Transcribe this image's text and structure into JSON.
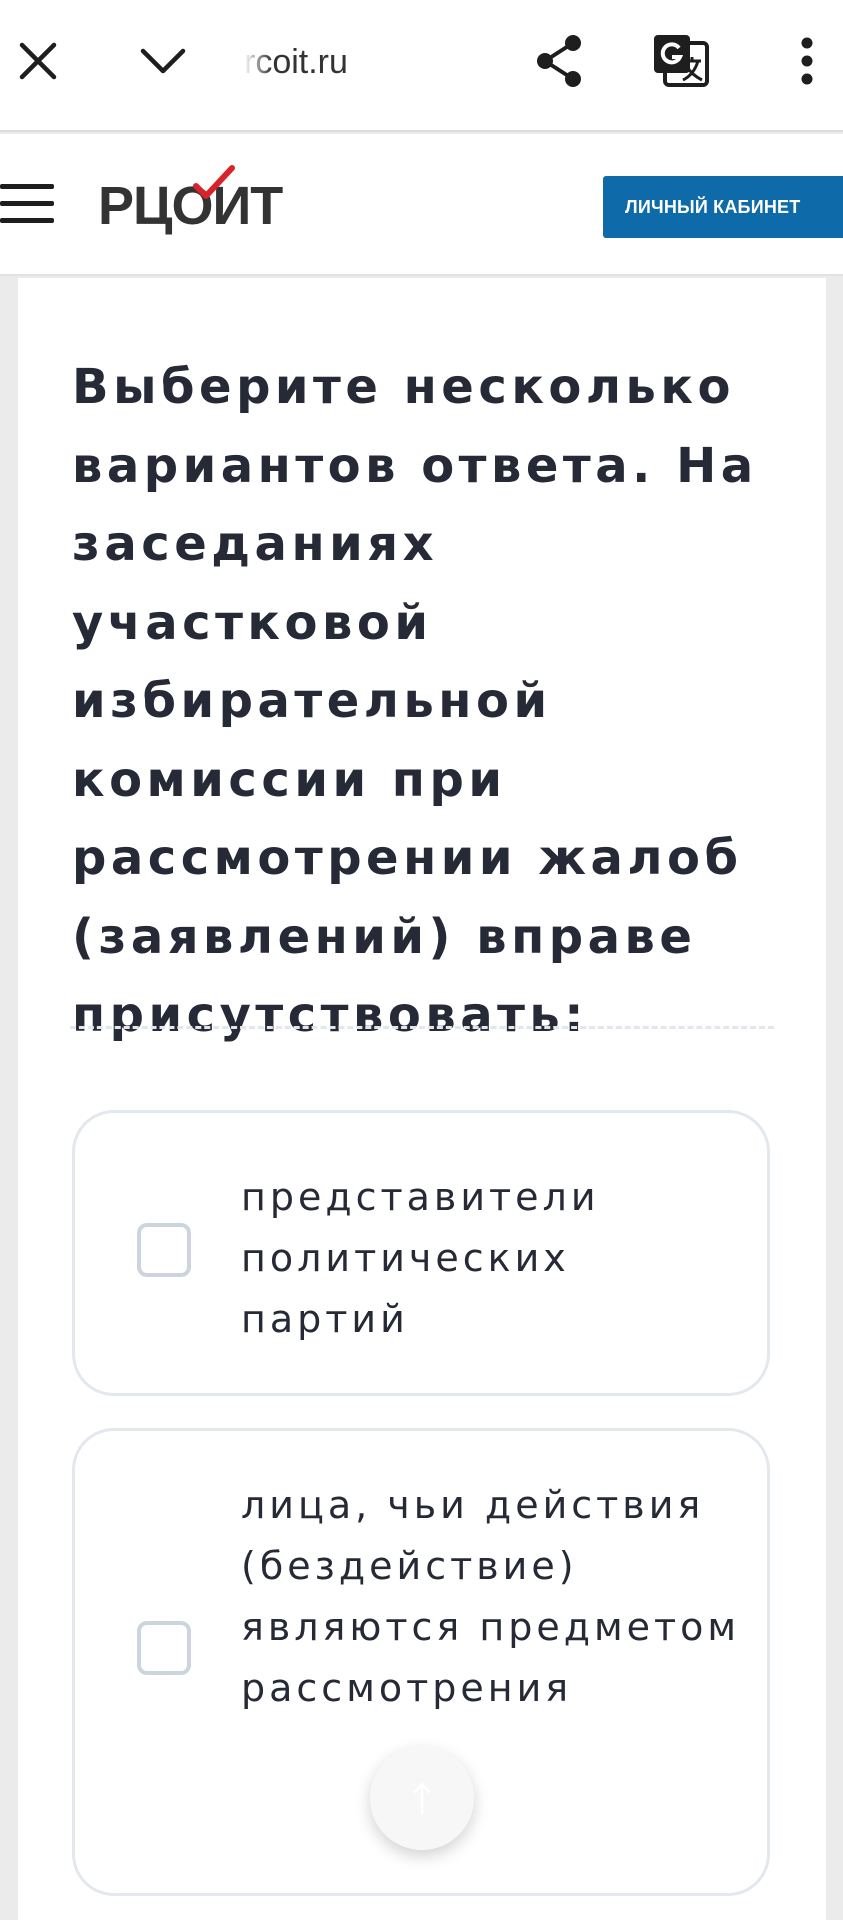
{
  "browser": {
    "url": "rcoit.ru",
    "icons": {
      "close": "close-icon",
      "collapse": "chevron-down-icon",
      "share": "share-icon",
      "translate": "translate-icon",
      "menu": "more-vertical-icon"
    }
  },
  "header": {
    "logo_text": "РЦОИТ",
    "cabinet_button": "ЛИЧНЫЙ КАБИНЕТ",
    "colors": {
      "button": "#0f6aa9",
      "logo_check": "#d8232a",
      "logo_text": "#333333"
    }
  },
  "quiz": {
    "question": "Выберите несколько вариантов ответа. На заседаниях участковой избирательной комиссии при рассмотрении жалоб (заявлений) вправе присутствовать:",
    "options": [
      {
        "label": "представители политических партий",
        "checked": false
      },
      {
        "label": "лица, чьи действия (бездействие) являются предметом рассмотрения",
        "checked": false
      }
    ]
  },
  "colors": {
    "text": "#262a36",
    "option_border": "#e3e8ee",
    "checkbox_border": "#ccd5de",
    "page_background": "#ebebeb"
  }
}
